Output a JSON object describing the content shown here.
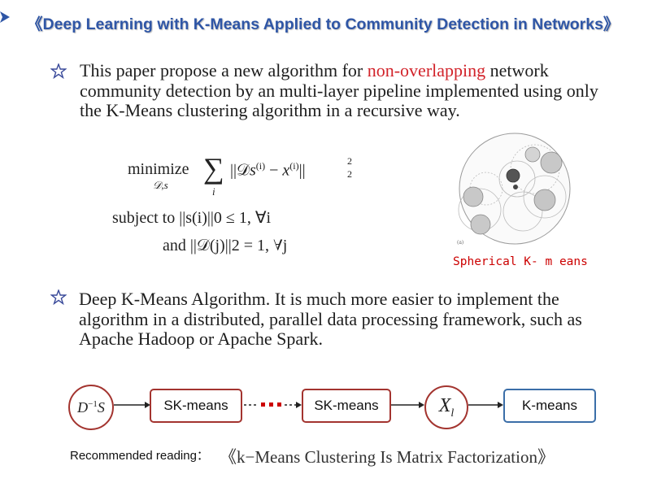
{
  "title": "《Deep Learning with K-Means Applied to Community Detection in Networks》",
  "bullet1": {
    "before": "This paper propose a new algorithm for ",
    "highlight": "non-overlapping",
    "after": " network community detection by an multi-layer pipeline implemented using only the K-Means clustering algorithm in a recursive way."
  },
  "formula": {
    "minimize": "minimize",
    "minimize_sub": "𝒟,s",
    "sum_index": "i",
    "objective": "||𝒟s(i) − x(i)||",
    "sup_i": "(i)",
    "norm_sup": "2",
    "norm_sub": "2",
    "subject_to": "subject to ||s(i)||0 ≤ 1, ∀i",
    "and_line": "and ||𝒟(j)||2 = 1, ∀j"
  },
  "figure": {
    "caption": "Spherical K- m eans",
    "panel_label": "(a)"
  },
  "bullet2": {
    "text": "Deep K-Means Algorithm. It is much more easier to implement the algorithm in a distributed, parallel data processing framework, such as Apache Hadoop or Apache Spark."
  },
  "pipeline": {
    "input_node": "D",
    "input_sup": "−1",
    "input_s": "S",
    "step1": "SK-means",
    "ellipsis": "···",
    "step2": "SK-means",
    "x_node": "X",
    "x_sub": "l",
    "final": "K-means"
  },
  "footer": {
    "label": "Recommended reading：",
    "book": "《k−Means Clustering Is Matrix Factorization》"
  },
  "colors": {
    "title": "#2F56A6",
    "highlight": "#D2232A",
    "box_border": "#a3342f",
    "final_box_border": "#3b6ea8"
  }
}
